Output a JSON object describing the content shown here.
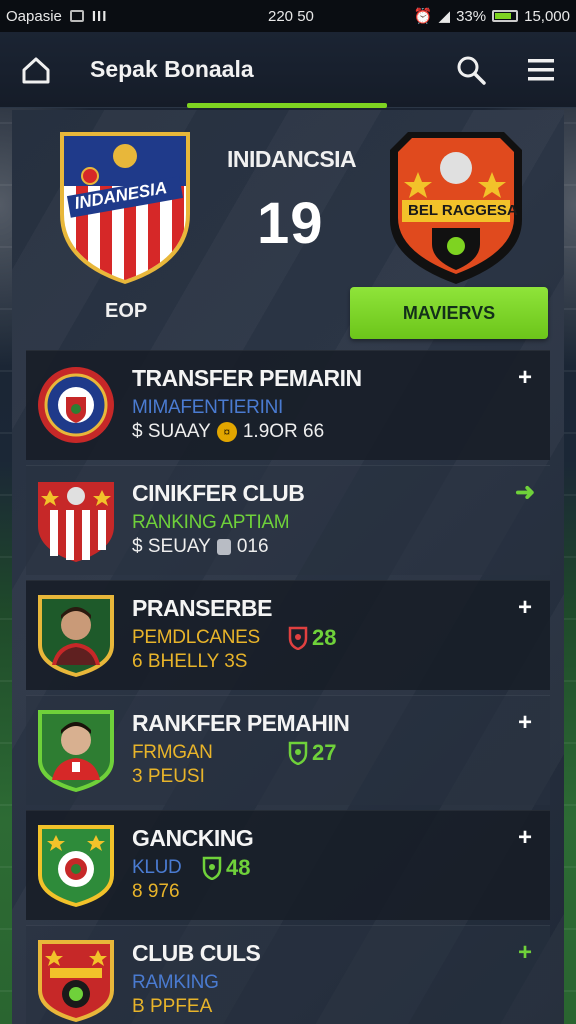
{
  "status_bar": {
    "carrier": "Oapasie",
    "signal": "III",
    "time": "220 50",
    "battery_percent": "33%",
    "extra": "15,000"
  },
  "app_bar": {
    "title": "Sepak Bonaala",
    "icons": [
      "home-icon",
      "search-icon",
      "menu-icon"
    ]
  },
  "match": {
    "left_crest_text": "INDANESIA",
    "left_label": "EOP",
    "team_name": "INIDANCSIA",
    "score": "19",
    "right_crest_text": "BEL RAGGESA",
    "button_label": "MAVIERVS"
  },
  "list": [
    {
      "title": "TRANSFER PEMARIN",
      "subtitle": "MIMAFENTIERINI",
      "subtitle_color": "#4a7bd1",
      "meta_prefix": "$ SUAAY",
      "meta_icon": "coin-icon",
      "meta_value": "1.9OR 66",
      "action": "+",
      "action_color": "#ffffff"
    },
    {
      "title": "CINIKFER CLUB",
      "subtitle": "RANKING APTIAM",
      "subtitle_color": "#6fd13a",
      "meta_prefix": "$ SEUAY",
      "meta_icon": "can-icon",
      "meta_value": "016",
      "action": "➜",
      "action_color": "#6fd13a"
    },
    {
      "title": "PRANSERBE",
      "subtitle": "PEMDLCANES",
      "subtitle_color": "#e8b42a",
      "meta_value": "6 BHELLY 3S",
      "meta_color": "#e8b42a",
      "rating": "28",
      "rating_icon_color": "#e04040",
      "action": "+",
      "action_color": "#ffffff"
    },
    {
      "title": "RANKFER PEMAHIN",
      "subtitle": "FRMGAN",
      "subtitle_color": "#e8b42a",
      "meta_value": "3 PEUSI",
      "meta_color": "#e8b42a",
      "rating": "27",
      "rating_icon_color": "#6fd13a",
      "action": "+",
      "action_color": "#ffffff"
    },
    {
      "title": "GANCKING",
      "subtitle": "KLUD",
      "subtitle_color": "#4a7bd1",
      "meta_value": "8 976",
      "meta_color": "#e8b42a",
      "rating": "48",
      "rating_icon_color": "#6fd13a",
      "action": "+",
      "action_color": "#ffffff"
    },
    {
      "title": "CLUB CULS",
      "subtitle": "RAMKING",
      "subtitle_color": "#4a7bd1",
      "meta_value": "B PPFEA",
      "meta_color": "#e8b42a",
      "action": "+",
      "action_color": "#6fd13a"
    }
  ]
}
